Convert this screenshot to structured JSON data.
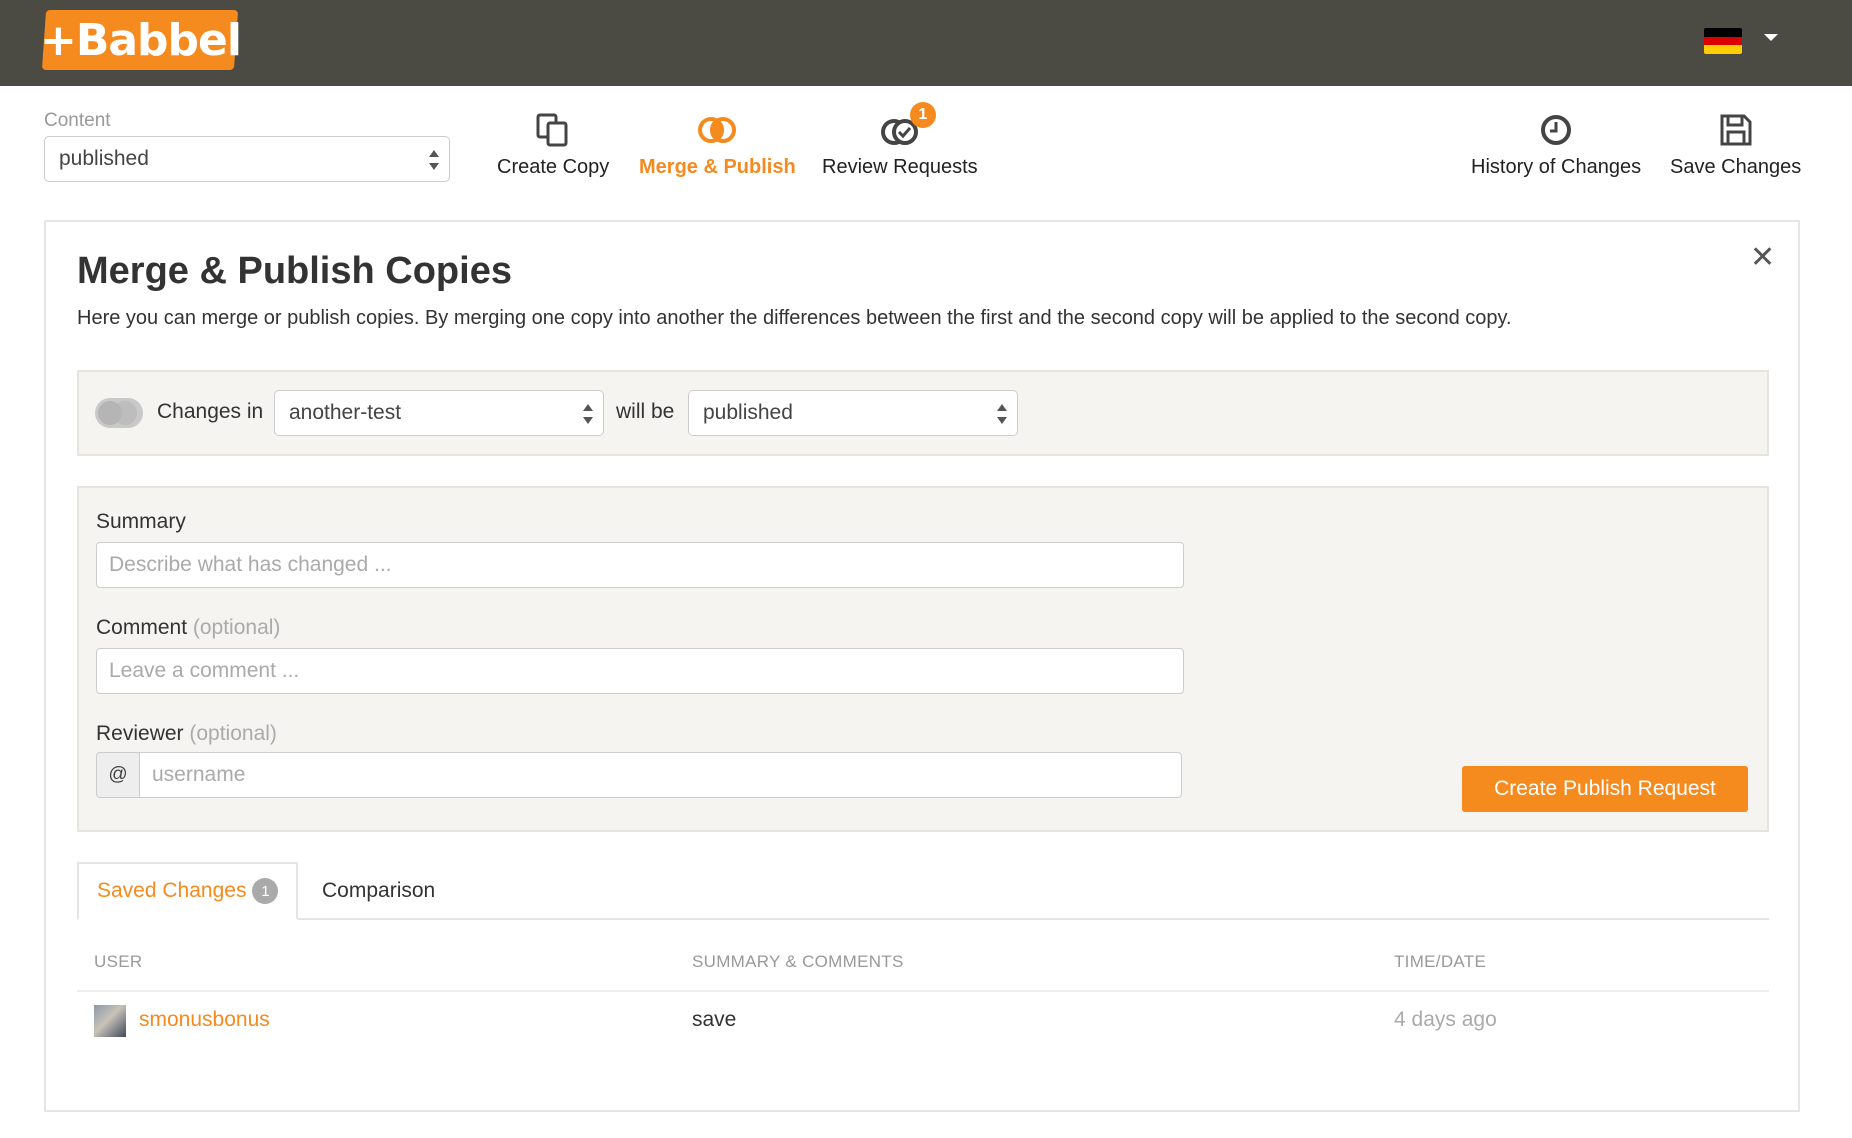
{
  "app": {
    "logo_text": "+Babbel",
    "brand_color": "#f58a1f",
    "topbar_color": "#4b4b44"
  },
  "header": {
    "language_flag": "germany-flag-icon"
  },
  "content": {
    "label": "Content",
    "selected": "published"
  },
  "toolbar": {
    "create_copy": "Create Copy",
    "merge_publish": "Merge & Publish",
    "review_requests": "Review Requests",
    "review_badge": "1",
    "history": "History of Changes",
    "save": "Save Changes"
  },
  "panel": {
    "title": "Merge & Publish Copies",
    "description": "Here you can merge or publish copies. By merging one copy into another the differences between the first and the second copy will be applied to the second copy.",
    "changes_in_label": "Changes in",
    "source_selected": "another-test",
    "will_be_label": "will be",
    "target_selected": "published"
  },
  "form": {
    "summary_label": "Summary",
    "summary_placeholder": "Describe what has changed ...",
    "comment_label": "Comment",
    "comment_optional": "(optional)",
    "comment_placeholder": "Leave a comment ...",
    "reviewer_label": "Reviewer",
    "reviewer_optional": "(optional)",
    "reviewer_prefix": "@",
    "reviewer_placeholder": "username",
    "submit_label": "Create Publish Request"
  },
  "tabs": [
    {
      "label": "Saved Changes",
      "count": "1"
    },
    {
      "label": "Comparison"
    }
  ],
  "table": {
    "headers": [
      "USER",
      "SUMMARY & COMMENTS",
      "TIME/DATE"
    ],
    "rows": [
      {
        "user": "smonusbonus",
        "summary": "save",
        "time": "4 days ago"
      }
    ]
  }
}
